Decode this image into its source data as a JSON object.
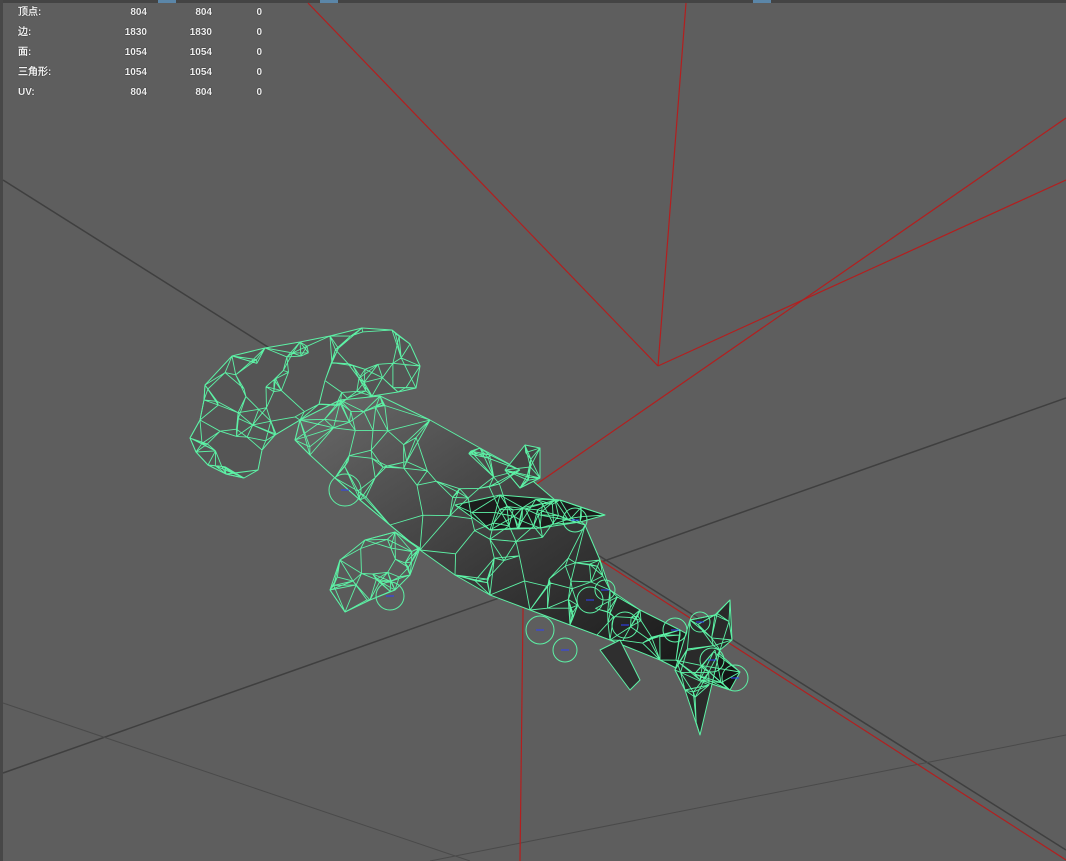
{
  "viewport": {
    "background": "#5e5e5e",
    "grid_color": "#3a3a3a",
    "axis_color": "#b41e1e",
    "wireframe_color": "#5df2a6",
    "ik_color": "#2f40ff"
  },
  "heads_up_display": {
    "rows": [
      {
        "label": "顶点:",
        "v1": "804",
        "v2": "804",
        "v3": "0"
      },
      {
        "label": "边:",
        "v1": "1830",
        "v2": "1830",
        "v3": "0"
      },
      {
        "label": "面:",
        "v1": "1054",
        "v2": "1054",
        "v3": "0"
      },
      {
        "label": "三角形:",
        "v1": "1054",
        "v2": "1054",
        "v3": "0"
      },
      {
        "label": "UV:",
        "v1": "804",
        "v2": "804",
        "v3": "0"
      }
    ]
  },
  "model": {
    "icon": "hammerhead-shark-wireframe-icon"
  }
}
